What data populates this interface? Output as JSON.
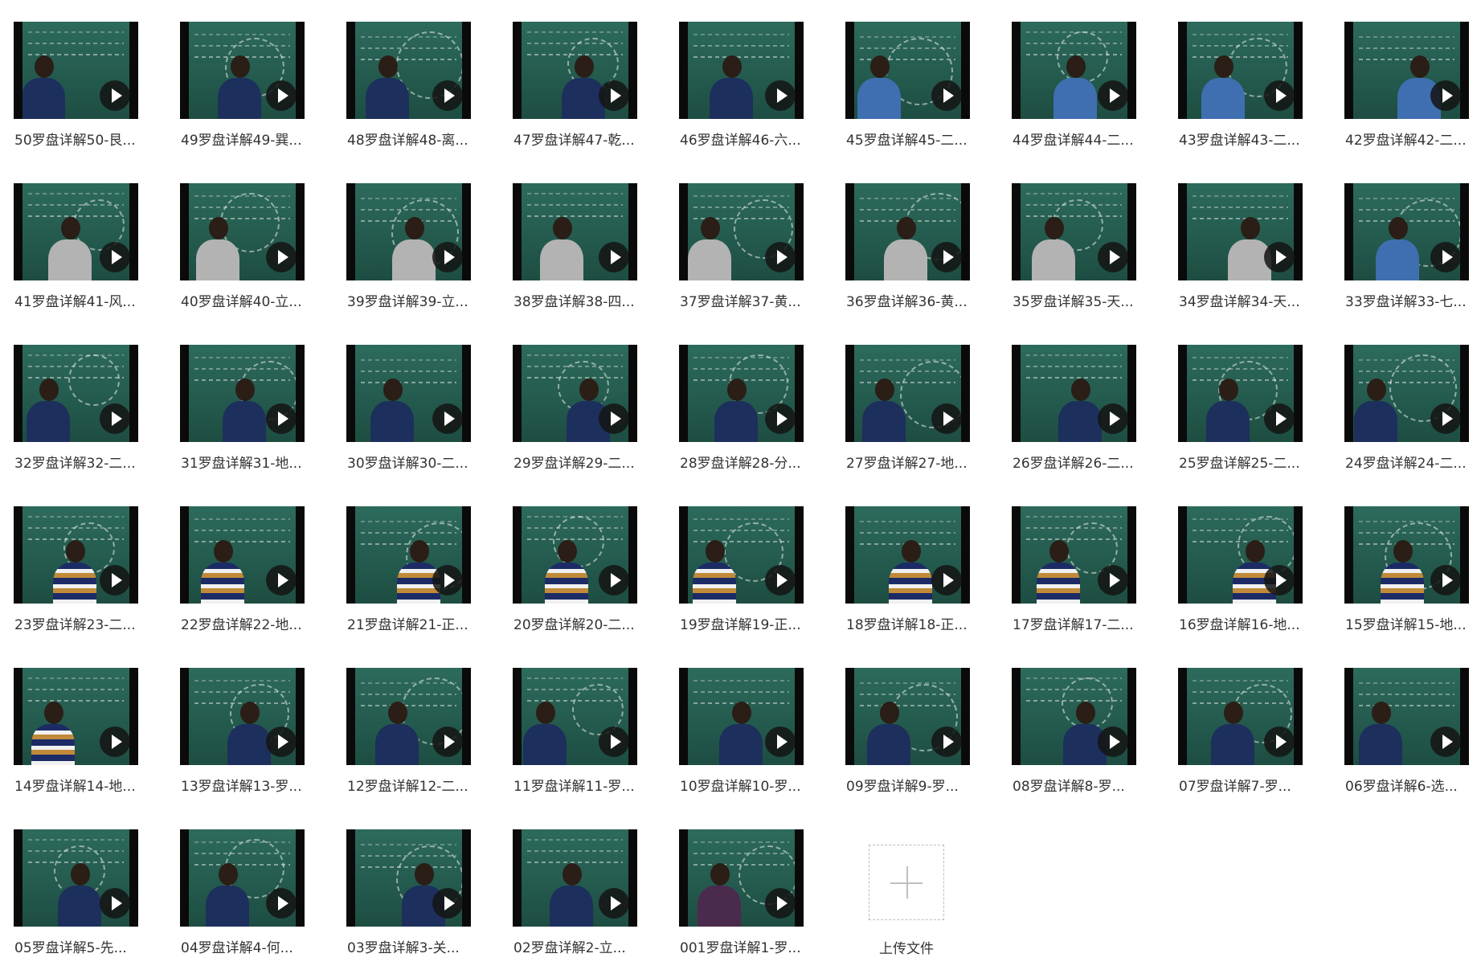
{
  "files": [
    {
      "name": "50罗盘详解50-艮...",
      "shirt": "navy"
    },
    {
      "name": "49罗盘详解49-巽...",
      "shirt": "navy"
    },
    {
      "name": "48罗盘详解48-离...",
      "shirt": "navy"
    },
    {
      "name": "47罗盘详解47-乾...",
      "shirt": "navy"
    },
    {
      "name": "46罗盘详解46-六...",
      "shirt": "navy"
    },
    {
      "name": "45罗盘详解45-二...",
      "shirt": "blue"
    },
    {
      "name": "44罗盘详解44-二...",
      "shirt": "blue"
    },
    {
      "name": "43罗盘详解43-二...",
      "shirt": "blue"
    },
    {
      "name": "42罗盘详解42-二...",
      "shirt": "blue"
    },
    {
      "name": "41罗盘详解41-风...",
      "shirt": "gray"
    },
    {
      "name": "40罗盘详解40-立...",
      "shirt": "gray"
    },
    {
      "name": "39罗盘详解39-立...",
      "shirt": "gray"
    },
    {
      "name": "38罗盘详解38-四...",
      "shirt": "gray"
    },
    {
      "name": "37罗盘详解37-黄...",
      "shirt": "gray"
    },
    {
      "name": "36罗盘详解36-黄...",
      "shirt": "gray"
    },
    {
      "name": "35罗盘详解35-天...",
      "shirt": "gray"
    },
    {
      "name": "34罗盘详解34-天...",
      "shirt": "gray"
    },
    {
      "name": "33罗盘详解33-七...",
      "shirt": "blue"
    },
    {
      "name": "32罗盘详解32-二...",
      "shirt": "navy"
    },
    {
      "name": "31罗盘详解31-地...",
      "shirt": "navy"
    },
    {
      "name": "30罗盘详解30-二...",
      "shirt": "navy"
    },
    {
      "name": "29罗盘详解29-二...",
      "shirt": "navy"
    },
    {
      "name": "28罗盘详解28-分...",
      "shirt": "navy"
    },
    {
      "name": "27罗盘详解27-地...",
      "shirt": "navy"
    },
    {
      "name": "26罗盘详解26-二...",
      "shirt": "navy"
    },
    {
      "name": "25罗盘详解25-二...",
      "shirt": "navy"
    },
    {
      "name": "24罗盘详解24-二...",
      "shirt": "navy"
    },
    {
      "name": "23罗盘详解23-二...",
      "shirt": "stripe"
    },
    {
      "name": "22罗盘详解22-地...",
      "shirt": "stripe"
    },
    {
      "name": "21罗盘详解21-正...",
      "shirt": "stripe"
    },
    {
      "name": "20罗盘详解20-二...",
      "shirt": "stripe"
    },
    {
      "name": "19罗盘详解19-正...",
      "shirt": "stripe"
    },
    {
      "name": "18罗盘详解18-正...",
      "shirt": "stripe"
    },
    {
      "name": "17罗盘详解17-二...",
      "shirt": "stripe"
    },
    {
      "name": "16罗盘详解16-地...",
      "shirt": "stripe"
    },
    {
      "name": "15罗盘详解15-地...",
      "shirt": "stripe"
    },
    {
      "name": "14罗盘详解14-地...",
      "shirt": "stripe"
    },
    {
      "name": "13罗盘详解13-罗...",
      "shirt": "navy"
    },
    {
      "name": "12罗盘详解12-二...",
      "shirt": "navy"
    },
    {
      "name": "11罗盘详解11-罗...",
      "shirt": "navy"
    },
    {
      "name": "10罗盘详解10-罗...",
      "shirt": "navy"
    },
    {
      "name": "09罗盘详解9-罗...",
      "shirt": "navy"
    },
    {
      "name": "08罗盘详解8-罗...",
      "shirt": "navy"
    },
    {
      "name": "07罗盘详解7-罗...",
      "shirt": "navy"
    },
    {
      "name": "06罗盘详解6-选...",
      "shirt": "navy"
    },
    {
      "name": "05罗盘详解5-先...",
      "shirt": "navy"
    },
    {
      "name": "04罗盘详解4-何...",
      "shirt": "navy"
    },
    {
      "name": "03罗盘详解3-关...",
      "shirt": "navy"
    },
    {
      "name": "02罗盘详解2-立...",
      "shirt": "navy"
    },
    {
      "name": "001罗盘详解1-罗...",
      "shirt": "purple"
    }
  ],
  "upload": {
    "label": "上传文件",
    "icon": "plus-icon"
  },
  "colors": {
    "board": "#245b4e",
    "label_text": "#333333",
    "play_bg": "#141414",
    "upload_border": "#bdbdbd"
  }
}
